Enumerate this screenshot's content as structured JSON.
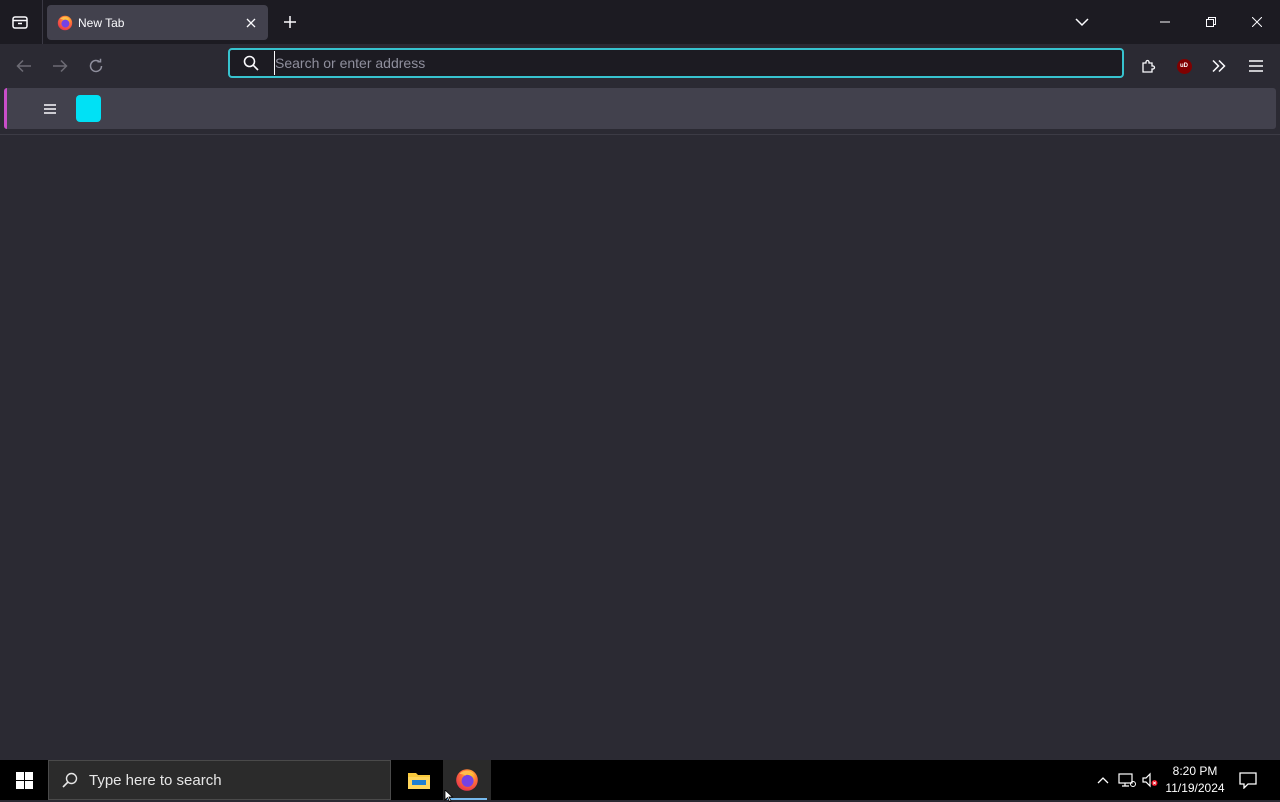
{
  "browser": {
    "tab_title": "New Tab",
    "urlbar": {
      "placeholder": "Search or enter address",
      "value": ""
    },
    "extension_badge": "uD",
    "accent_color": "#37c3cf",
    "bookmark_tile_color": "#00e1f5"
  },
  "icons": {
    "tab_overview": "tab-overview-icon",
    "firefox": "firefox-icon",
    "close": "close-icon",
    "new_tab": "plus-icon",
    "list_all_tabs": "chevron-down-icon",
    "minimize": "minimize-icon",
    "restore": "restore-icon",
    "window_close": "close-icon",
    "back": "back-arrow-icon",
    "forward": "forward-arrow-icon",
    "reload": "reload-icon",
    "search": "search-icon",
    "extensions": "puzzle-icon",
    "ublock": "ublock-origin-icon",
    "overflow": "double-chevron-icon",
    "menu": "hamburger-icon"
  },
  "taskbar": {
    "search_placeholder": "Type here to search",
    "time": "8:20 PM",
    "date": "11/19/2024",
    "apps": [
      "File Explorer",
      "Firefox"
    ]
  }
}
